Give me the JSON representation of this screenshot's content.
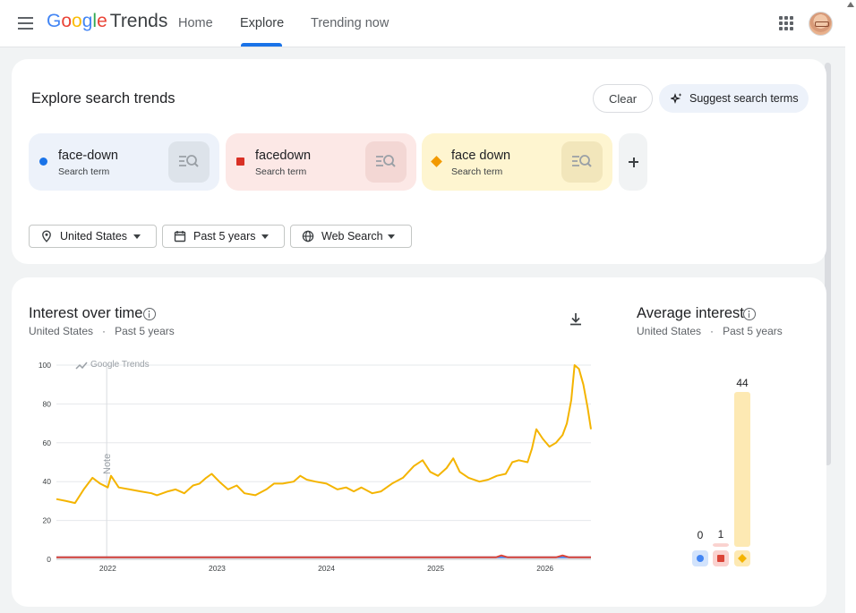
{
  "header": {
    "logo_google": "Google",
    "logo_trends": "Trends",
    "nav": [
      "Home",
      "Explore",
      "Trending now"
    ]
  },
  "explore": {
    "title": "Explore search trends",
    "clear_label": "Clear",
    "suggest_label": "Suggest search terms",
    "terms": [
      {
        "name": "face-down",
        "type": "Search term",
        "color": "#1a73e8",
        "bg": "#edf2fa",
        "icon_bg": "#dde3ea",
        "marker": "circle"
      },
      {
        "name": "facedown",
        "type": "Search term",
        "color": "#d93025",
        "bg": "#fce8e6",
        "icon_bg": "#f3d7d4",
        "marker": "square"
      },
      {
        "name": "face down",
        "type": "Search term",
        "color": "#f29900",
        "bg": "#fef5d0",
        "icon_bg": "#f2e6bb",
        "marker": "diamond"
      }
    ],
    "filters": {
      "region": "United States",
      "time": "Past 5 years",
      "property": "Web Search"
    }
  },
  "interest_over_time": {
    "title": "Interest over time",
    "region": "United States",
    "time": "Past 5 years",
    "watermark": "Google Trends",
    "note_label": "Note"
  },
  "average_interest": {
    "title": "Average interest",
    "region": "United States",
    "time": "Past 5 years"
  },
  "chart_data": [
    {
      "type": "line",
      "ylim": [
        0,
        100
      ],
      "yticks": [
        0,
        20,
        40,
        60,
        80,
        100
      ],
      "xticks": [
        {
          "label": "2022",
          "x": 2022.0
        },
        {
          "label": "2023",
          "x": 2023.0
        },
        {
          "label": "2024",
          "x": 2024.0
        },
        {
          "label": "2025",
          "x": 2025.0
        },
        {
          "label": "2026",
          "x": 2026.0
        }
      ],
      "xlim": [
        2021.53,
        2026.42
      ],
      "grid": true,
      "note_x": 2021.99,
      "series": [
        {
          "name": "face-down",
          "color": "#4285f4",
          "points": [
            [
              2021.53,
              1
            ],
            [
              2026.42,
              1
            ]
          ]
        },
        {
          "name": "facedown",
          "color": "#db4437",
          "points": [
            [
              2021.53,
              1
            ],
            [
              2023.0,
              1
            ],
            [
              2024.0,
              1
            ],
            [
              2025.0,
              1
            ],
            [
              2025.55,
              1
            ],
            [
              2025.6,
              2
            ],
            [
              2025.66,
              1
            ],
            [
              2026.1,
              1
            ],
            [
              2026.16,
              2
            ],
            [
              2026.22,
              1
            ],
            [
              2026.42,
              1
            ]
          ]
        },
        {
          "name": "face down",
          "color": "#f4b400",
          "points": [
            [
              2021.53,
              31
            ],
            [
              2021.62,
              30
            ],
            [
              2021.7,
              29
            ],
            [
              2021.78,
              36
            ],
            [
              2021.86,
              42
            ],
            [
              2021.93,
              39
            ],
            [
              2022.0,
              37
            ],
            [
              2022.03,
              43
            ],
            [
              2022.1,
              37
            ],
            [
              2022.2,
              36
            ],
            [
              2022.3,
              35
            ],
            [
              2022.4,
              34
            ],
            [
              2022.45,
              33
            ],
            [
              2022.55,
              35
            ],
            [
              2022.62,
              36
            ],
            [
              2022.7,
              34
            ],
            [
              2022.78,
              38
            ],
            [
              2022.84,
              39
            ],
            [
              2022.9,
              42
            ],
            [
              2022.95,
              44
            ],
            [
              2023.02,
              40
            ],
            [
              2023.1,
              36
            ],
            [
              2023.18,
              38
            ],
            [
              2023.25,
              34
            ],
            [
              2023.35,
              33
            ],
            [
              2023.45,
              36
            ],
            [
              2023.52,
              39
            ],
            [
              2023.6,
              39
            ],
            [
              2023.7,
              40
            ],
            [
              2023.76,
              43
            ],
            [
              2023.82,
              41
            ],
            [
              2023.9,
              40
            ],
            [
              2024.0,
              39
            ],
            [
              2024.1,
              36
            ],
            [
              2024.18,
              37
            ],
            [
              2024.25,
              35
            ],
            [
              2024.32,
              37
            ],
            [
              2024.42,
              34
            ],
            [
              2024.5,
              35
            ],
            [
              2024.6,
              39
            ],
            [
              2024.7,
              42
            ],
            [
              2024.8,
              48
            ],
            [
              2024.88,
              51
            ],
            [
              2024.95,
              45
            ],
            [
              2025.02,
              43
            ],
            [
              2025.1,
              47
            ],
            [
              2025.16,
              52
            ],
            [
              2025.22,
              45
            ],
            [
              2025.3,
              42
            ],
            [
              2025.4,
              40
            ],
            [
              2025.48,
              41
            ],
            [
              2025.56,
              43
            ],
            [
              2025.64,
              44
            ],
            [
              2025.7,
              50
            ],
            [
              2025.76,
              51
            ],
            [
              2025.84,
              50
            ],
            [
              2025.88,
              57
            ],
            [
              2025.92,
              67
            ],
            [
              2025.98,
              62
            ],
            [
              2026.04,
              58
            ],
            [
              2026.1,
              60
            ],
            [
              2026.16,
              64
            ],
            [
              2026.2,
              70
            ],
            [
              2026.24,
              82
            ],
            [
              2026.27,
              100
            ],
            [
              2026.31,
              98
            ],
            [
              2026.35,
              90
            ],
            [
              2026.39,
              78
            ],
            [
              2026.42,
              67
            ]
          ]
        }
      ]
    },
    {
      "type": "bar",
      "categories": [
        "face-down",
        "facedown",
        "face down"
      ],
      "values": [
        0,
        1,
        44
      ],
      "colors": [
        "#4285f4",
        "#db4437",
        "#f4b400"
      ],
      "value_labels": [
        "0",
        "1",
        "44"
      ],
      "ylim": [
        0,
        44
      ]
    }
  ]
}
